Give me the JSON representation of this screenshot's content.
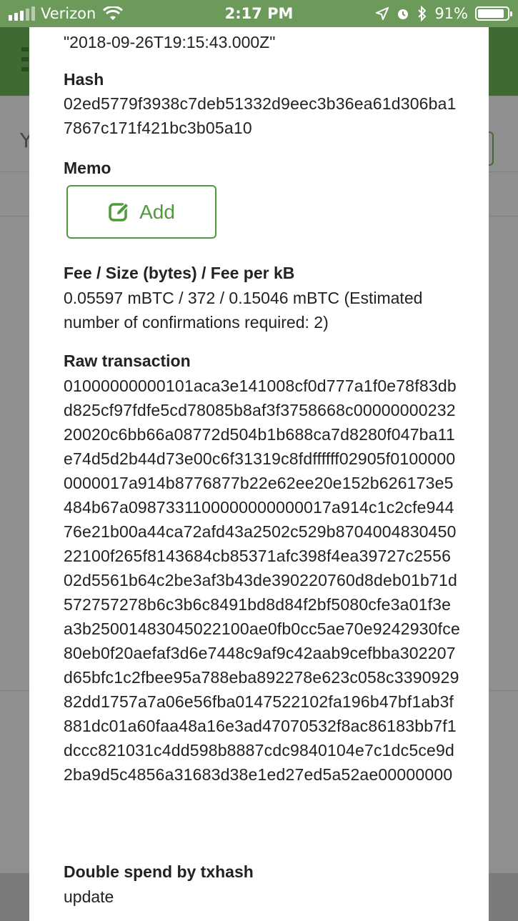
{
  "status_bar": {
    "carrier": "Verizon",
    "time": "2:17 PM",
    "battery": "91%",
    "battery_level": 0.91
  },
  "modal": {
    "timestamp_value": "\"2018-09-26T19:15:43.000Z\"",
    "hash": {
      "label": "Hash",
      "value": "02ed5779f3938c7deb51332d9eec3b36ea61d306ba17867c171f421bc3b05a10"
    },
    "memo": {
      "label": "Memo",
      "add_label": "Add",
      "accent": "#4f9a3c"
    },
    "fee": {
      "label": "Fee / Size (bytes) / Fee per kB",
      "value": "0.05597 mBTC / 372 / 0.15046 mBTC (Estimated number of confirmations required: 2)"
    },
    "raw": {
      "label": "Raw transaction",
      "value": "01000000000101aca3e141008cf0d777a1f0e78f83dbd825cf97fdfe5cd78085b8af3f3758668c0000000023220020c6bb66a08772d504b1b688ca7d8280f047ba11e74d5d2b44d73e00c6f31319c8fdffffff02905f01000000000017a914b8776877b22e62ee20e152b626173e5484b67a0987331100000000000017a914c1c2cfe94476e21b00a44ca72afd43a2502c529b870400483045022100f265f8143684cb85371afc398f4ea39727c255602d5561b64c2be3af3b43de390220760d8deb01b71d572757278b6c3b6c8491bd8d84f2bf5080cfe3a01f3ea3b25001483045022100ae0fb0cc5ae70e9242930fce80eb0f20aefaf3d6e7448c9af9c42aab9cefbba302207d65bfc1c2fbee95a788eba892278e623c058c339092982dd1757a7a06e56fba0147522102fa196b47bf1ab3f881dc01a60faa48a16e3ad47070532f8ac86183bb7f1dccc821031c4dd598b8887cdc9840104e7c1dc5ce9d2ba9d5c4856a31683d38e1ed27ed5a52ae00000000"
    },
    "double_spend": {
      "label": "Double spend by txhash",
      "value": "update"
    }
  },
  "colors": {
    "status_bar": "#6c9a5a",
    "header_bg": "#3f6a32",
    "overlay": "#8f8f8f"
  }
}
